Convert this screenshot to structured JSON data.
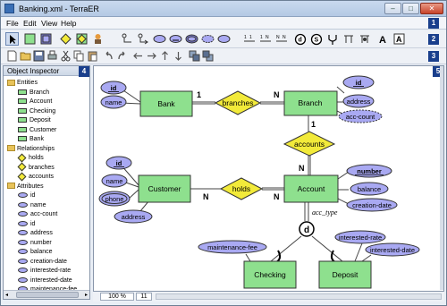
{
  "window": {
    "title": "Banking.xml - TerraER"
  },
  "menu": [
    "File",
    "Edit",
    "View",
    "Help"
  ],
  "callouts": [
    "1",
    "2",
    "3",
    "4",
    "5"
  ],
  "panel": {
    "title": "Object Inspector",
    "groups": [
      {
        "label": "Entities",
        "icon": "folder-icon",
        "kind": "entity",
        "items": [
          "Branch",
          "Account",
          "Checking",
          "Deposit",
          "Customer",
          "Bank"
        ]
      },
      {
        "label": "Relationships",
        "icon": "folder-icon",
        "kind": "relationship",
        "items": [
          "holds",
          "branches",
          "accounts"
        ]
      },
      {
        "label": "Attributes",
        "icon": "folder-icon",
        "kind": "attribute",
        "items": [
          "id",
          "name",
          "acc-count",
          "id",
          "address",
          "number",
          "balance",
          "creation-date",
          "interested-rate",
          "interested-date",
          "maintenance-fee"
        ]
      }
    ]
  },
  "status": {
    "zoom": "100 %",
    "page": "11"
  },
  "diagram": {
    "entities": {
      "bank": "Bank",
      "branch": "Branch",
      "customer": "Customer",
      "account": "Account",
      "checking": "Checking",
      "deposit": "Deposit"
    },
    "relationships": {
      "branches": "branches",
      "accounts": "accounts",
      "holds": "holds"
    },
    "attributes": {
      "bank_id": "id",
      "bank_name": "name",
      "branch_id": "id",
      "branch_address": "address",
      "branch_acc_count": "acc-count",
      "cust_id": "id",
      "cust_name": "name",
      "cust_phone": "phone",
      "cust_address": "address",
      "acc_number": "number",
      "acc_balance": "balance",
      "acc_creation": "creation-date",
      "maint_fee": "maintenance-fee",
      "int_rate": "interested-rate",
      "int_date": "interested-date"
    },
    "cardinalities": {
      "bank_branches": "1",
      "branches_branch": "N",
      "branch_accounts": "1",
      "accounts_account": "N",
      "customer_holds": "N",
      "holds_account": "N"
    },
    "specialization": {
      "label": "acc_type",
      "symbol": "d"
    }
  },
  "colors": {
    "entity": "#8ee08e",
    "relationship": "#f2ea3a",
    "attribute": "#a9a9f2",
    "badge": "#1a3f8c"
  }
}
